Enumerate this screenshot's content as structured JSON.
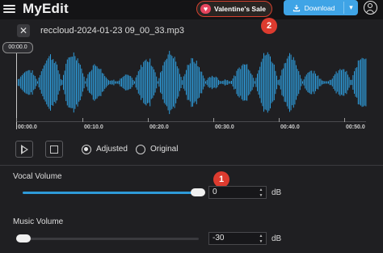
{
  "header": {
    "brand": "MyEdit",
    "sale_label": "Valentine's Sale",
    "download_label": "Download",
    "icons": [
      "menu-icon",
      "heart-icon",
      "download-icon",
      "chevron-down-icon",
      "user-account-icon"
    ]
  },
  "annotations": {
    "badge_1": "1",
    "badge_2": "2"
  },
  "file": {
    "close_label": "✕",
    "name": "reccloud-2024-01-23 09_00_33.mp3"
  },
  "timeline": {
    "current_time": "00:00.0",
    "ticks": [
      "00:00.0",
      "00:10.0",
      "00:20.0",
      "00:30.0",
      "00:40.0",
      "00:50.0"
    ]
  },
  "playback": {
    "mode_options": [
      "Adjusted",
      "Original"
    ],
    "selected_mode": "Adjusted"
  },
  "vocal": {
    "label": "Vocal Volume",
    "value": "0",
    "unit": "dB",
    "level_fraction": 1.0
  },
  "music": {
    "label": "Music Volume",
    "value": "-30",
    "unit": "dB",
    "level_fraction": 0.0
  },
  "colors": {
    "accent": "#3fa4e6",
    "waveform": "#2e9ad8",
    "badge": "#dd3b2f",
    "sale_border": "#d5402e",
    "background": "#1f1f22"
  }
}
